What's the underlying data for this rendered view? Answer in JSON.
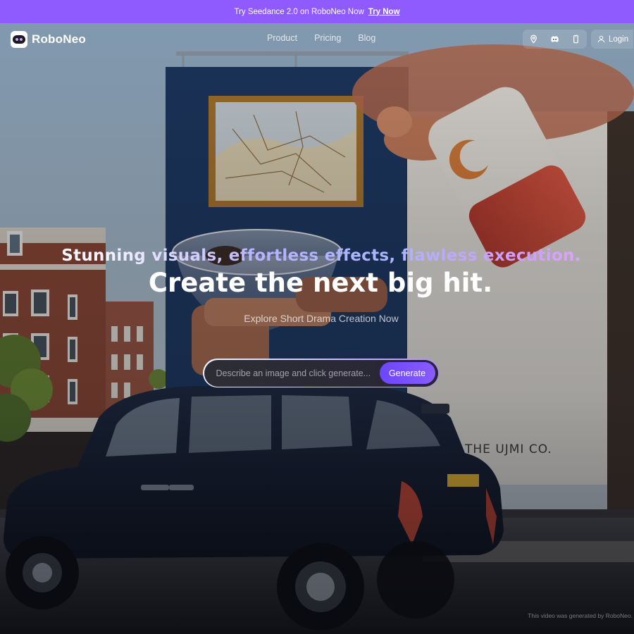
{
  "announcement": {
    "text": "Try Seedance 2.0 on RoboNeo Now",
    "cta": "Try Now"
  },
  "brand": {
    "name": "RoboNeo"
  },
  "nav": {
    "links": [
      "Product",
      "Pricing",
      "Blog"
    ],
    "icons": [
      "location-pin-icon",
      "discord-icon",
      "phone-icon"
    ],
    "login_label": "Login",
    "login_icon": "user-icon"
  },
  "hero": {
    "tagline": "Stunning visuals, effortless effects, flawless execution.",
    "headline": "Create the next big hit.",
    "subline": "Explore Short Drama Creation Now",
    "prompt_placeholder": "Describe an image and click generate...",
    "generate_label": "Generate",
    "background_sign_text": "THE UJMI CO.",
    "credit": "This video was generated by RoboNeo."
  },
  "colors": {
    "announcement_bar": "#8f5bff",
    "generate_button": "#7550ff",
    "taxi": "#121a2a",
    "billboard_wall": "#1c3760"
  }
}
